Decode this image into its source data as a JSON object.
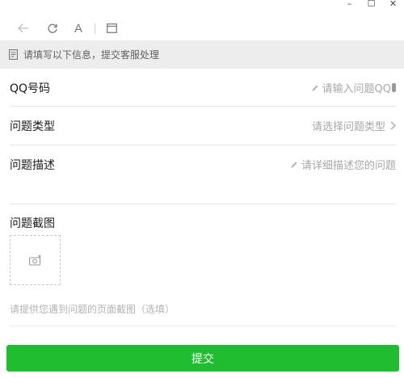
{
  "window_controls": {
    "minimize": "–",
    "maximize": "☐",
    "close": "✕"
  },
  "toolbar": {
    "font_label": "A",
    "icons": [
      "back-arrow-icon",
      "refresh-icon",
      "font-icon",
      "window-icon"
    ]
  },
  "notice": {
    "text": "请填写以下信息，提交客服处理",
    "icon": "document-icon"
  },
  "form": {
    "qq": {
      "label": "QQ号码",
      "placeholder": "请输入问题QQ"
    },
    "type": {
      "label": "问题类型",
      "placeholder": "请选择问题类型"
    },
    "description": {
      "label": "问题描述",
      "placeholder": "请详细描述您的问题"
    },
    "screenshot": {
      "label": "问题截图",
      "hint": "请提供您遇到问题的页面截图（选填）"
    }
  },
  "submit": {
    "label": "提交"
  },
  "colors": {
    "accent": "#1fbd2f",
    "notice_bg": "#ededed",
    "placeholder": "#a7a7a7"
  }
}
